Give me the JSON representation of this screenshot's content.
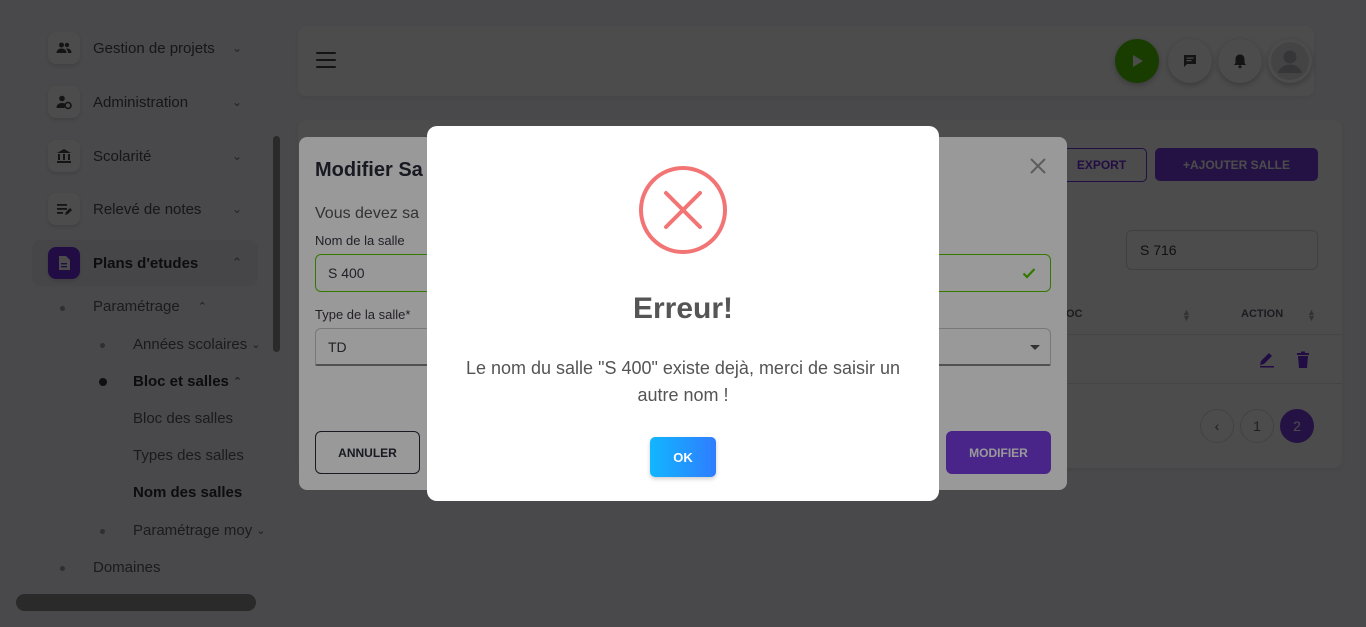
{
  "sidebar": {
    "items": [
      {
        "label": "Gestion de projets",
        "icon": "people-icon"
      },
      {
        "label": "Administration",
        "icon": "user-gear-icon"
      },
      {
        "label": "Scolarité",
        "icon": "bank-icon"
      },
      {
        "label": "Relevé de notes",
        "icon": "edit-list-icon"
      },
      {
        "label": "Plans d'etudes",
        "icon": "document-icon"
      }
    ],
    "sub": {
      "parametrage": "Paramétrage",
      "annees": "Années scolaires",
      "bloc_et_salles": "Bloc et salles",
      "bloc_des_salles": "Bloc des salles",
      "types_des_salles": "Types des salles",
      "nom_des_salles": "Nom des salles",
      "parametrage_moy": "Paramétrage moy",
      "domaines": "Domaines"
    }
  },
  "card": {
    "export_label": "EXPORT",
    "add_label": "+AJOUTER SALLE",
    "search_value": "S 716",
    "col_bloc": "OC",
    "col_action": "ACTION",
    "pages": [
      "1",
      "2"
    ],
    "current_page": "2"
  },
  "dialog": {
    "title": "Modifier Sa",
    "subtitle": "Vous devez sa",
    "name_label": "Nom de la salle",
    "name_value": "S 400",
    "type_label": "Type de la salle*",
    "type_value": "TD",
    "cancel_label": "ANNULER",
    "submit_label": "MODIFIER"
  },
  "alert": {
    "title": "Erreur!",
    "message": "Le nom du salle \"S 400\" existe dejà, merci de saisir un autre nom !",
    "ok_label": "OK"
  },
  "colors": {
    "primary": "#7b3fe4",
    "success": "#56ca00",
    "error": "#f27474",
    "ok_gradient": [
      "#11b6ff",
      "#2f7dff"
    ]
  }
}
